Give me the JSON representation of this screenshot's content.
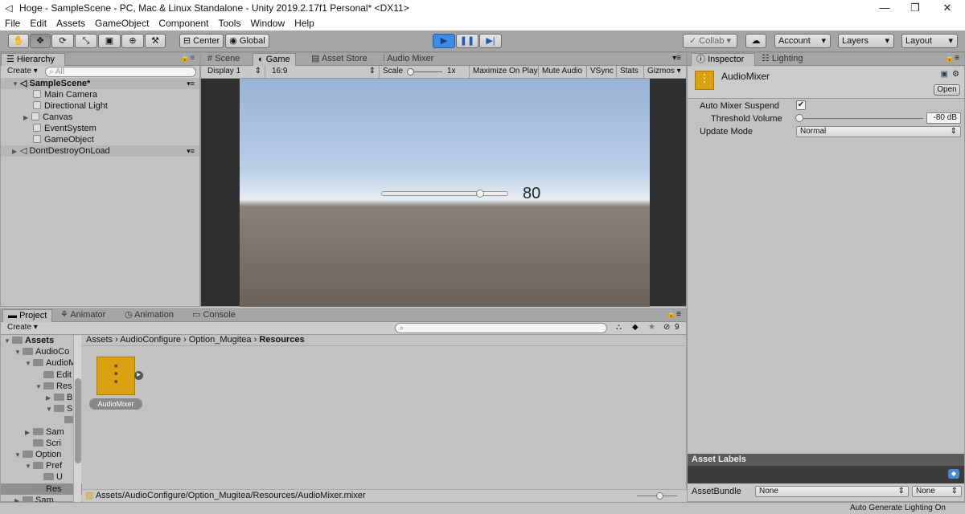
{
  "window": {
    "title": "Hoge - SampleScene - PC, Mac & Linux Standalone - Unity 2019.2.17f1 Personal* <DX11>",
    "minimize": "—",
    "maximize": "❐",
    "close": "✕"
  },
  "menu": [
    "File",
    "Edit",
    "Assets",
    "GameObject",
    "Component",
    "Tools",
    "Window",
    "Help"
  ],
  "toolbar": {
    "center": "Center",
    "global": "Global",
    "collab": "Collab",
    "account": "Account",
    "layers": "Layers",
    "layout": "Layout"
  },
  "hierarchy": {
    "tab": "Hierarchy",
    "create": "Create",
    "search_placeholder": "All",
    "scene": "SampleScene*",
    "objects": [
      "Main Camera",
      "Directional Light",
      "Canvas",
      "EventSystem",
      "GameObject"
    ],
    "dontdestroy": "DontDestroyOnLoad"
  },
  "center_tabs": [
    "Scene",
    "Game",
    "Asset Store",
    "Audio Mixer"
  ],
  "game_toolbar": {
    "display": "Display 1",
    "aspect": "16:9",
    "scale": "Scale",
    "scale_value": "1x",
    "maximize": "Maximize On Play",
    "mute": "Mute Audio",
    "vsync": "VSync",
    "stats": "Stats",
    "gizmos": "Gizmos"
  },
  "game_view": {
    "slider_fraction": 0.78,
    "slider_value": "80"
  },
  "inspector": {
    "tab": "Inspector",
    "lighting_tab": "Lighting",
    "asset_name": "AudioMixer",
    "open": "Open",
    "auto_mixer_label": "Auto Mixer Suspend",
    "threshold_label": "Threshold Volume",
    "threshold_value": "-80 dB",
    "update_mode_label": "Update Mode",
    "update_mode": "Normal",
    "asset_labels": "Asset Labels",
    "assetbundle_label": "AssetBundle",
    "assetbundle_value": "None",
    "assetbundle_variant": "None"
  },
  "project": {
    "tabs": [
      "Project",
      "Animator",
      "Animation",
      "Console"
    ],
    "create": "Create",
    "count": "9",
    "breadcrumb": [
      "Assets",
      "AudioConfigure",
      "Option_Mugitea",
      "Resources"
    ],
    "tree": [
      {
        "label": "Assets",
        "depth": 0,
        "bold": true
      },
      {
        "label": "AudioCo",
        "depth": 1
      },
      {
        "label": "AudioM",
        "depth": 2
      },
      {
        "label": "Edit",
        "depth": 3
      },
      {
        "label": "Res",
        "depth": 3
      },
      {
        "label": "B",
        "depth": 4
      },
      {
        "label": "S",
        "depth": 4
      },
      {
        "label": "",
        "depth": 5
      },
      {
        "label": "Sam",
        "depth": 2
      },
      {
        "label": "Scri",
        "depth": 2
      },
      {
        "label": "Option",
        "depth": 1
      },
      {
        "label": "Pref",
        "depth": 2
      },
      {
        "label": "U",
        "depth": 3
      },
      {
        "label": "Res",
        "depth": 2
      },
      {
        "label": "Sam",
        "depth": 1
      }
    ],
    "asset_label": "AudioMixer",
    "path": "Assets/AudioConfigure/Option_Mugitea/Resources/AudioMixer.mixer"
  },
  "status": {
    "text": "Auto Generate Lighting On"
  },
  "colors": {
    "accent": "#3d8be5",
    "mixer": "#d9a010",
    "sky_top": "#98b3d6",
    "ground": "#6b625c"
  }
}
